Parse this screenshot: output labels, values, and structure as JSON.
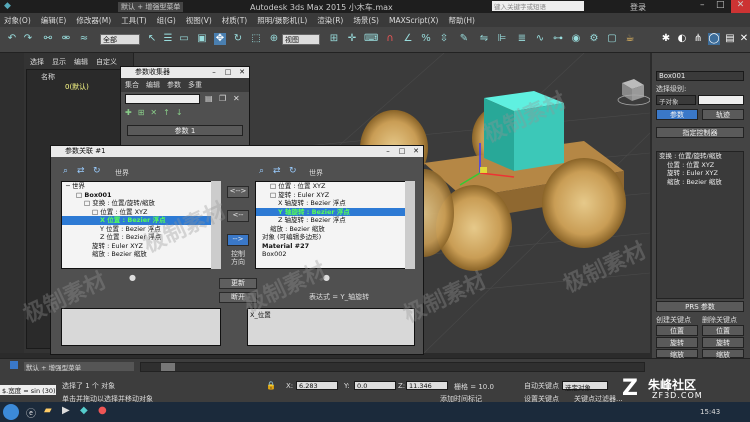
{
  "app": {
    "title": "Autodesk 3ds Max  2015    小木车.max",
    "tab": "默认 + 增强型菜单",
    "search_placeholder": "键入关键字或短语",
    "login": "登录"
  },
  "menu": [
    "对象(O)",
    "编辑(E)",
    "修改器(M)",
    "工具(T)",
    "组(G)",
    "视图(V)",
    "材质(T)",
    "照明/摄影机(L)",
    "渲染(R)",
    "场景(S)",
    "MAXScript(X)",
    "帮助(H)"
  ],
  "toolbar": {
    "filter": "全部",
    "view": "视图"
  },
  "scene_explorer": {
    "tabs": [
      "选择",
      "显示",
      "编辑",
      "自定义"
    ],
    "col": "名称",
    "item": "0(默认)"
  },
  "param_editor": {
    "title": "参数收集器",
    "menu": [
      "集合",
      "编辑",
      "参数",
      "多重"
    ],
    "rollout": "参数 1"
  },
  "wire": {
    "title": "参数关联 #1",
    "left_header": "世界",
    "right_header": "世界",
    "left_tree": [
      "─ 世界",
      "□ Box001",
      "□ 变换 : 位置/旋转/缩放",
      "□ 位置 : 位置 XYZ",
      "X 位置 : Bezier 浮点",
      "Y 位置 : Bezier 浮点",
      "Z 位置 : Bezier 浮点",
      "旋转 : Euler XYZ",
      "缩放 : Bezier 缩放"
    ],
    "right_tree": [
      "□ 位置 : 位置 XYZ",
      "□ 旋转 : Euler XYZ",
      "X 轴旋转 : Bezier 浮点",
      "Y 轴旋转 : Bezier 浮点",
      "Z 轴旋转 : Bezier 浮点",
      "缩放 : Bezier 缩放",
      "对象 (可编辑多边形)",
      "Material #27",
      "Box002"
    ],
    "arrow_right": "-->",
    "arrow_left": "<--",
    "arrow_both": "<-->",
    "control_dir": "控制方向",
    "update": "更新",
    "disconnect": "断开",
    "expr_label": "表达式 = Y_轴旋转",
    "left_expr": "",
    "right_expr": "X_位置"
  },
  "right_panel": {
    "object": "Box001",
    "sel_label": "选择级别:",
    "sub": "子对象",
    "tabs": [
      "参数",
      "轨迹"
    ],
    "controller": "指定控制器",
    "tree": [
      "变换 : 位置/旋转/缩放",
      "位置 : 位置 XYZ",
      "旋转 : Euler XYZ",
      "缩放 : Bezier 缩放"
    ],
    "prs": "PRS 参数",
    "create_key": "创建关键点",
    "delete_key": "删除关键点",
    "btns": [
      "位置",
      "旋转",
      "缩放"
    ]
  },
  "status": {
    "selected": "选择了 1 个 对象",
    "hint": "单击并拖动以选择并移动对象",
    "x": "6.283",
    "y": "0.0",
    "z": "11.346",
    "grid": "栅格 = 10.0",
    "autokey": "自动关键点",
    "setkey": "设置关键点",
    "keyfilter": "关键点过滤器...",
    "sel_obj": "选定对象",
    "add_tag": "添加时间标记",
    "frame": "0",
    "script": "$.宽度 = sin (30)",
    "tab_bottom": "默认 + 增强型菜单"
  },
  "taskbar": {
    "time": "15:43"
  },
  "watermarks": [
    "极制素材",
    "极制素材",
    "极制素材",
    "极制素材",
    "极制素材",
    "极制素材"
  ],
  "logo": {
    "name": "朱峰社区",
    "url": "ZF3D.COM"
  }
}
